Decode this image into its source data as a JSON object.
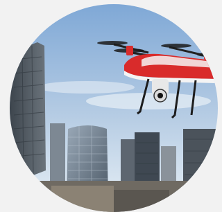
{
  "image": {
    "subject": "drone-over-city",
    "icon": "drone-icon",
    "colors": {
      "background": "#f2f2f2",
      "sky_top": "#7fa8d6",
      "sky_bottom": "#e8f0f6",
      "drone_body": "#d92b2b",
      "drone_white": "#f4f4f4",
      "buildings": "#5d6670"
    }
  }
}
